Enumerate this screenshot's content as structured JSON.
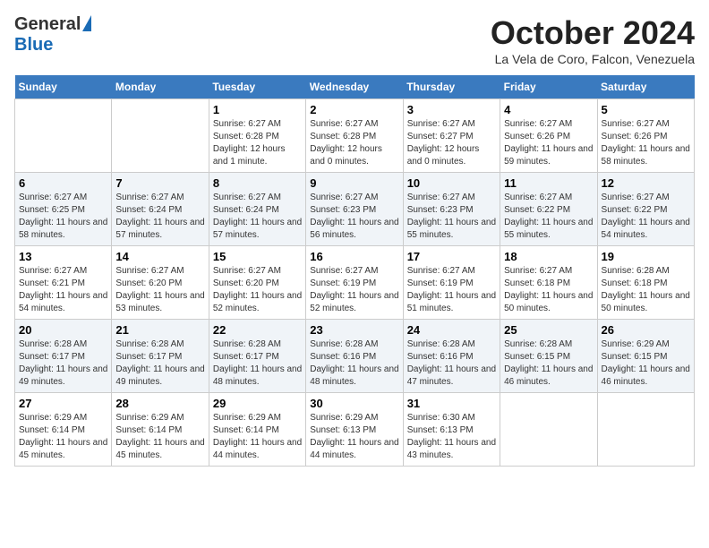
{
  "logo": {
    "general": "General",
    "blue": "Blue"
  },
  "title": "October 2024",
  "location": "La Vela de Coro, Falcon, Venezuela",
  "days_of_week": [
    "Sunday",
    "Monday",
    "Tuesday",
    "Wednesday",
    "Thursday",
    "Friday",
    "Saturday"
  ],
  "weeks": [
    [
      {
        "day": "",
        "info": ""
      },
      {
        "day": "",
        "info": ""
      },
      {
        "day": "1",
        "info": "Sunrise: 6:27 AM\nSunset: 6:28 PM\nDaylight: 12 hours and 1 minute."
      },
      {
        "day": "2",
        "info": "Sunrise: 6:27 AM\nSunset: 6:28 PM\nDaylight: 12 hours and 0 minutes."
      },
      {
        "day": "3",
        "info": "Sunrise: 6:27 AM\nSunset: 6:27 PM\nDaylight: 12 hours and 0 minutes."
      },
      {
        "day": "4",
        "info": "Sunrise: 6:27 AM\nSunset: 6:26 PM\nDaylight: 11 hours and 59 minutes."
      },
      {
        "day": "5",
        "info": "Sunrise: 6:27 AM\nSunset: 6:26 PM\nDaylight: 11 hours and 58 minutes."
      }
    ],
    [
      {
        "day": "6",
        "info": "Sunrise: 6:27 AM\nSunset: 6:25 PM\nDaylight: 11 hours and 58 minutes."
      },
      {
        "day": "7",
        "info": "Sunrise: 6:27 AM\nSunset: 6:24 PM\nDaylight: 11 hours and 57 minutes."
      },
      {
        "day": "8",
        "info": "Sunrise: 6:27 AM\nSunset: 6:24 PM\nDaylight: 11 hours and 57 minutes."
      },
      {
        "day": "9",
        "info": "Sunrise: 6:27 AM\nSunset: 6:23 PM\nDaylight: 11 hours and 56 minutes."
      },
      {
        "day": "10",
        "info": "Sunrise: 6:27 AM\nSunset: 6:23 PM\nDaylight: 11 hours and 55 minutes."
      },
      {
        "day": "11",
        "info": "Sunrise: 6:27 AM\nSunset: 6:22 PM\nDaylight: 11 hours and 55 minutes."
      },
      {
        "day": "12",
        "info": "Sunrise: 6:27 AM\nSunset: 6:22 PM\nDaylight: 11 hours and 54 minutes."
      }
    ],
    [
      {
        "day": "13",
        "info": "Sunrise: 6:27 AM\nSunset: 6:21 PM\nDaylight: 11 hours and 54 minutes."
      },
      {
        "day": "14",
        "info": "Sunrise: 6:27 AM\nSunset: 6:20 PM\nDaylight: 11 hours and 53 minutes."
      },
      {
        "day": "15",
        "info": "Sunrise: 6:27 AM\nSunset: 6:20 PM\nDaylight: 11 hours and 52 minutes."
      },
      {
        "day": "16",
        "info": "Sunrise: 6:27 AM\nSunset: 6:19 PM\nDaylight: 11 hours and 52 minutes."
      },
      {
        "day": "17",
        "info": "Sunrise: 6:27 AM\nSunset: 6:19 PM\nDaylight: 11 hours and 51 minutes."
      },
      {
        "day": "18",
        "info": "Sunrise: 6:27 AM\nSunset: 6:18 PM\nDaylight: 11 hours and 50 minutes."
      },
      {
        "day": "19",
        "info": "Sunrise: 6:28 AM\nSunset: 6:18 PM\nDaylight: 11 hours and 50 minutes."
      }
    ],
    [
      {
        "day": "20",
        "info": "Sunrise: 6:28 AM\nSunset: 6:17 PM\nDaylight: 11 hours and 49 minutes."
      },
      {
        "day": "21",
        "info": "Sunrise: 6:28 AM\nSunset: 6:17 PM\nDaylight: 11 hours and 49 minutes."
      },
      {
        "day": "22",
        "info": "Sunrise: 6:28 AM\nSunset: 6:17 PM\nDaylight: 11 hours and 48 minutes."
      },
      {
        "day": "23",
        "info": "Sunrise: 6:28 AM\nSunset: 6:16 PM\nDaylight: 11 hours and 48 minutes."
      },
      {
        "day": "24",
        "info": "Sunrise: 6:28 AM\nSunset: 6:16 PM\nDaylight: 11 hours and 47 minutes."
      },
      {
        "day": "25",
        "info": "Sunrise: 6:28 AM\nSunset: 6:15 PM\nDaylight: 11 hours and 46 minutes."
      },
      {
        "day": "26",
        "info": "Sunrise: 6:29 AM\nSunset: 6:15 PM\nDaylight: 11 hours and 46 minutes."
      }
    ],
    [
      {
        "day": "27",
        "info": "Sunrise: 6:29 AM\nSunset: 6:14 PM\nDaylight: 11 hours and 45 minutes."
      },
      {
        "day": "28",
        "info": "Sunrise: 6:29 AM\nSunset: 6:14 PM\nDaylight: 11 hours and 45 minutes."
      },
      {
        "day": "29",
        "info": "Sunrise: 6:29 AM\nSunset: 6:14 PM\nDaylight: 11 hours and 44 minutes."
      },
      {
        "day": "30",
        "info": "Sunrise: 6:29 AM\nSunset: 6:13 PM\nDaylight: 11 hours and 44 minutes."
      },
      {
        "day": "31",
        "info": "Sunrise: 6:30 AM\nSunset: 6:13 PM\nDaylight: 11 hours and 43 minutes."
      },
      {
        "day": "",
        "info": ""
      },
      {
        "day": "",
        "info": ""
      }
    ]
  ]
}
